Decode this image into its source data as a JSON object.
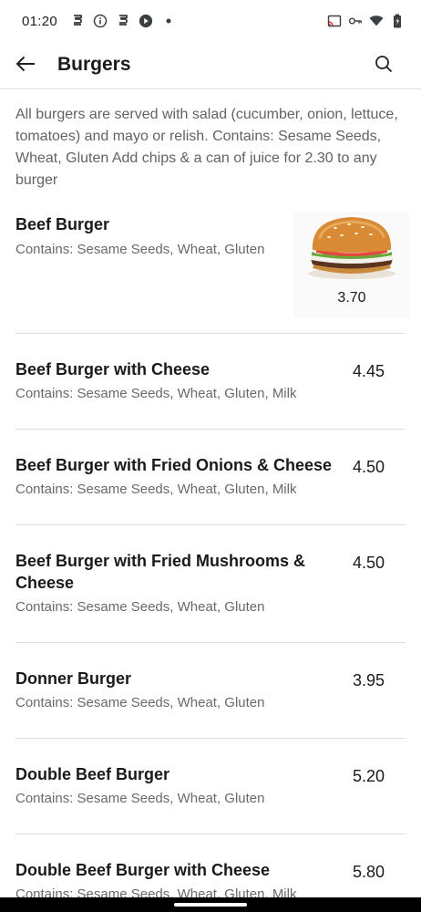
{
  "status_bar": {
    "time": "01:20",
    "left_icons": [
      "s-app-icon",
      "info-icon",
      "s-app-icon",
      "play-badge-icon",
      "dot-icon"
    ],
    "right_icons": [
      "cast-icon",
      "vpn-key-icon",
      "wifi-icon",
      "battery-icon"
    ]
  },
  "app_bar": {
    "title": "Burgers",
    "back_icon": "arrow-left-icon",
    "search_icon": "search-icon"
  },
  "category": {
    "description": "All burgers are served with salad (cucumber, onion, lettuce, tomatoes) and mayo or relish. Contains: Sesame Seeds, Wheat, Gluten Add chips & a can of juice for 2.30 to any burger"
  },
  "items": [
    {
      "name": "Beef Burger",
      "allergens": "Contains: Sesame Seeds, Wheat, Gluten",
      "price": "3.70",
      "has_image": true
    },
    {
      "name": "Beef Burger with Cheese",
      "allergens": "Contains: Sesame Seeds, Wheat, Gluten, Milk",
      "price": "4.45"
    },
    {
      "name": "Beef Burger with Fried Onions & Cheese",
      "allergens": "Contains: Sesame Seeds, Wheat, Gluten, Milk",
      "price": "4.50"
    },
    {
      "name": "Beef Burger with Fried Mushrooms & Cheese",
      "allergens": "Contains: Sesame Seeds, Wheat, Gluten",
      "price": "4.50"
    },
    {
      "name": "Donner Burger",
      "allergens": "Contains: Sesame Seeds, Wheat, Gluten",
      "price": "3.95"
    },
    {
      "name": "Double Beef Burger",
      "allergens": "Contains: Sesame Seeds, Wheat, Gluten",
      "price": "5.20"
    },
    {
      "name": "Double Beef Burger with Cheese",
      "allergens": "Contains: Sesame Seeds, Wheat, Gluten, Milk",
      "price": "5.80"
    }
  ]
}
